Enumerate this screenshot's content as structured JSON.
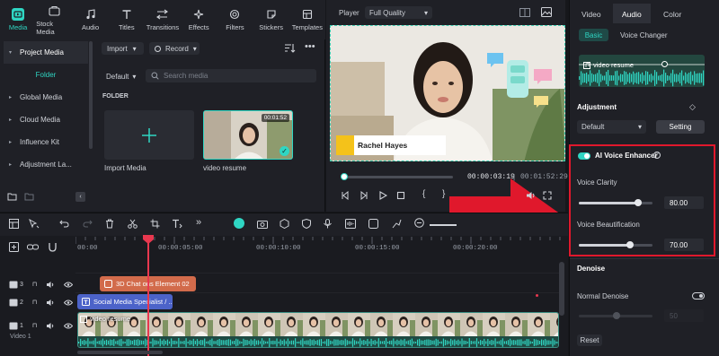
{
  "toolbar_tabs": [
    {
      "label": "Media",
      "icon": "media-icon",
      "active": true
    },
    {
      "label": "Stock Media",
      "icon": "stock-media-icon"
    },
    {
      "label": "Audio",
      "icon": "music-note-icon"
    },
    {
      "label": "Titles",
      "icon": "titles-icon"
    },
    {
      "label": "Transitions",
      "icon": "transitions-icon"
    },
    {
      "label": "Effects",
      "icon": "effects-icon"
    },
    {
      "label": "Filters",
      "icon": "filters-icon"
    },
    {
      "label": "Stickers",
      "icon": "stickers-icon"
    },
    {
      "label": "Templates",
      "icon": "templates-icon"
    }
  ],
  "sidebar": {
    "items": [
      {
        "label": "Project Media"
      },
      {
        "label": "Folder"
      },
      {
        "label": "Global Media"
      },
      {
        "label": "Cloud Media"
      },
      {
        "label": "Influence Kit"
      },
      {
        "label": "Adjustment La..."
      }
    ]
  },
  "media": {
    "import_label": "Import",
    "record_label": "Record",
    "sort_label": "Default",
    "search_placeholder": "Search media",
    "folder_heading": "FOLDER",
    "import_tile_label": "Import Media",
    "video_tile_label": "video resume",
    "video_tile_duration": "00:01:52"
  },
  "player": {
    "label": "Player",
    "quality": "Full Quality",
    "presenter_name": "Rachel Hayes",
    "time_current": "00:00:03:19",
    "time_separator": "|",
    "time_total": "00:01:52:29",
    "progress_fraction": 0.03
  },
  "right_panel": {
    "tabs": [
      "Video",
      "Audio",
      "Color"
    ],
    "active_tab": "Audio",
    "subtabs": [
      "Basic",
      "Voice Changer"
    ],
    "active_subtab": "Basic",
    "waveform_label": "video resume",
    "adjustment_heading": "Adjustment",
    "preset_value": "Default",
    "setting_label": "Setting",
    "ai_enhancer": {
      "title": "AI Voice Enhancer",
      "enabled": true,
      "voice_clarity_label": "Voice Clarity",
      "voice_clarity_value": "80.00",
      "voice_clarity_fraction": 0.8,
      "voice_beautification_label": "Voice Beautification",
      "voice_beautification_value": "70.00",
      "voice_beautification_fraction": 0.7
    },
    "denoise_heading": "Denoise",
    "normal_denoise_label": "Normal Denoise",
    "normal_denoise_enabled": false,
    "denoise_value": "50",
    "reset_label": "Reset"
  },
  "timeline": {
    "ruler_ticks": [
      "00:00",
      "00:00:05:00",
      "00:00:10:00",
      "00:00:15:00",
      "00:00:20:00"
    ],
    "tracks": [
      {
        "number": "3",
        "clip": "3D Chat Icons Element 02",
        "clip_visible": "3D Chat  ons Element 02"
      },
      {
        "number": "2",
        "clip": "Social Media Specialist / ..."
      },
      {
        "number": "1",
        "clip": "video resume",
        "track_name": "Video 1"
      }
    ]
  },
  "colors": {
    "accent": "#2fd6c3",
    "highlight_box": "#e0182c",
    "playhead": "#e8384f"
  }
}
